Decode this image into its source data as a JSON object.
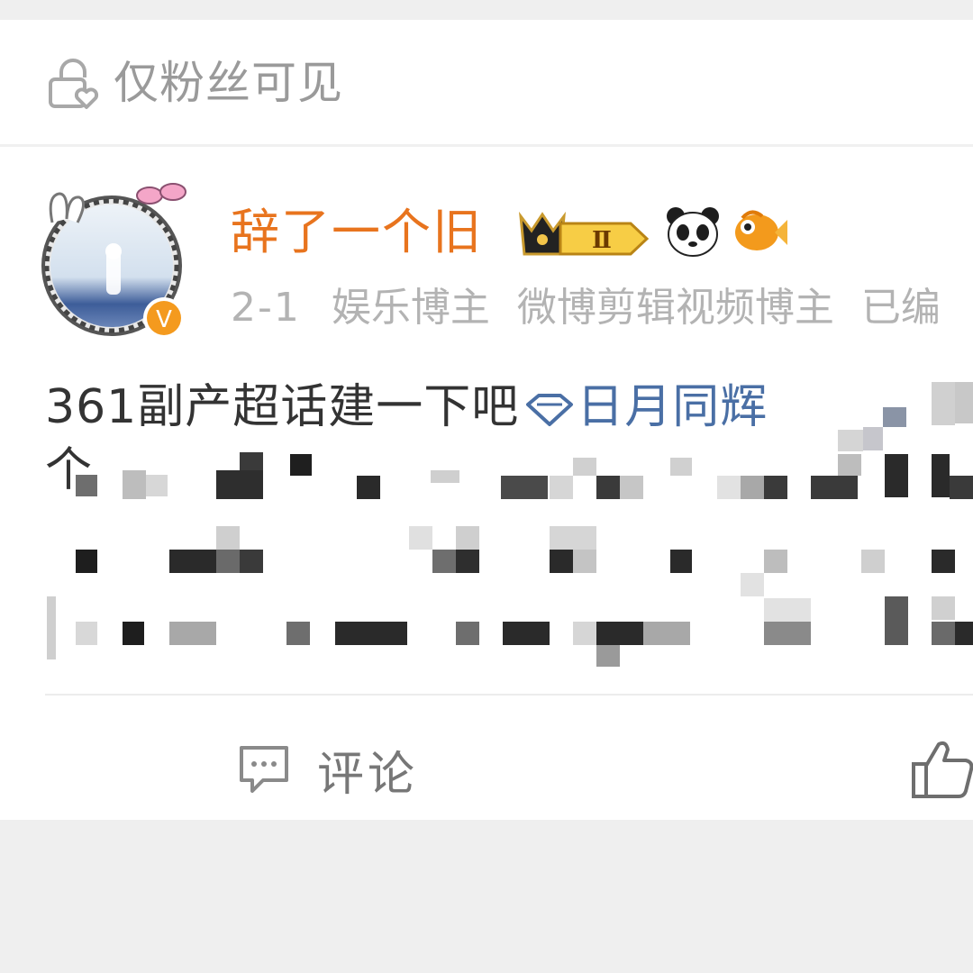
{
  "visibility": {
    "label": "仅粉丝可见",
    "icon": "lock-heart-icon"
  },
  "author": {
    "name": "辞了一个旧",
    "name_color": "#e8741e",
    "badges": [
      "crown-level-badge",
      "panda-emoji-icon",
      "goldfish-emoji-icon"
    ],
    "level": "Ⅱ",
    "verified_mark": "V"
  },
  "meta": {
    "date": "2-1",
    "tags": [
      "娱乐博主",
      "微博剪辑视频博主",
      "已编"
    ]
  },
  "post": {
    "text": "361副产超话建一下吧",
    "topic": "日月同辉",
    "line2_start": "个",
    "topic_color": "#4a6fa5"
  },
  "actions": {
    "comment_label": "评论",
    "comment_icon": "comment-bubble-icon",
    "like_icon": "thumbs-up-icon"
  }
}
